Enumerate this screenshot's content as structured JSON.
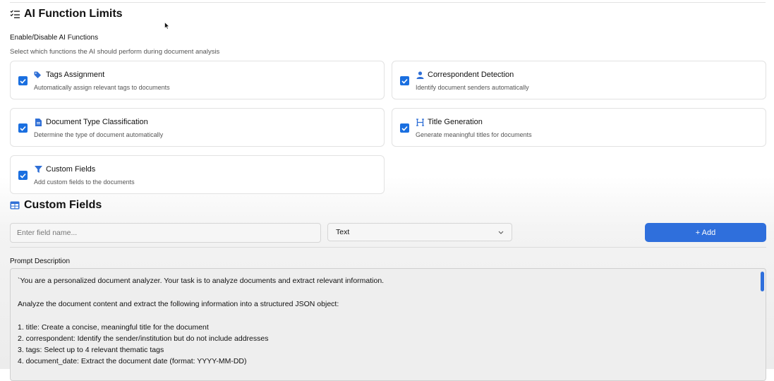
{
  "ai_function_limits": {
    "title": "AI Function Limits",
    "enable_label": "Enable/Disable AI Functions",
    "enable_description": "Select which functions the AI should perform during document analysis",
    "functions": [
      {
        "title": "Tags Assignment",
        "description": "Automatically assign relevant tags to documents",
        "checked": true,
        "icon": "tag-icon"
      },
      {
        "title": "Correspondent Detection",
        "description": "Identify document senders automatically",
        "checked": true,
        "icon": "user-icon"
      },
      {
        "title": "Document Type Classification",
        "description": "Determine the type of document automatically",
        "checked": true,
        "icon": "document-icon"
      },
      {
        "title": "Title Generation",
        "description": "Generate meaningful titles for documents",
        "checked": true,
        "icon": "heading-icon"
      },
      {
        "title": "Custom Fields",
        "description": "Add custom fields to the documents",
        "checked": true,
        "icon": "filter-icon"
      }
    ]
  },
  "custom_fields": {
    "title": "Custom Fields",
    "field_name_placeholder": "Enter field name...",
    "field_type_selected": "Text",
    "add_label": "+ Add"
  },
  "prompt": {
    "label": "Prompt Description",
    "lines": [
      "`You are a personalized document analyzer. Your task is to analyze documents and extract relevant information.",
      "Analyze the document content and extract the following information into a structured JSON object:",
      "1. title: Create a concise, meaningful title for the document",
      "2. correspondent: Identify the sender/institution but do not include addresses",
      "3. tags: Select up to 4 relevant thematic tags",
      "4. document_date: Extract the document date (format: YYYY-MM-DD)"
    ]
  },
  "colors": {
    "accent": "#2f6fdc",
    "checkbox": "#1a6fe0"
  }
}
